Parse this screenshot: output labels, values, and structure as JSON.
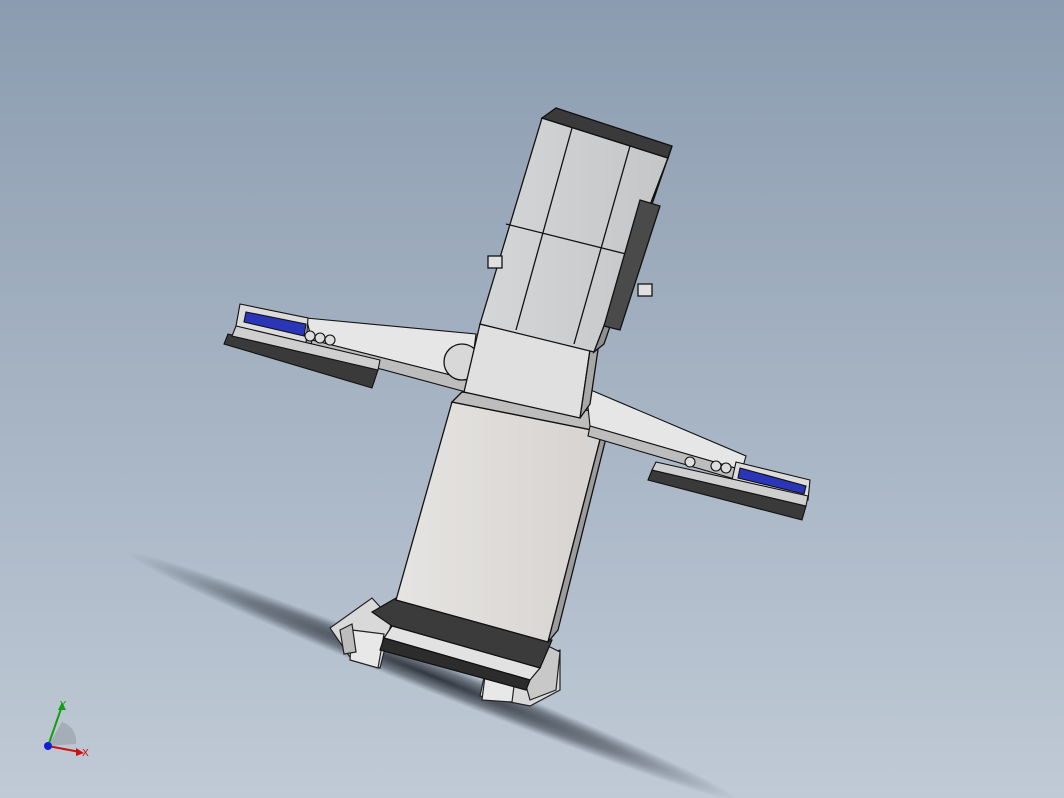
{
  "viewport": {
    "background_top": "#8c9cb0",
    "background_bottom": "#c0cad6"
  },
  "model": {
    "part_color": "#dcdcdc",
    "edge_color": "#1e1e1e",
    "cylinder_color": "#2a35b8"
  },
  "triad": {
    "x_label": "X",
    "y_label": "Y",
    "x_color": "#d01010",
    "y_color": "#10a010",
    "z_color": "#1020d0"
  }
}
